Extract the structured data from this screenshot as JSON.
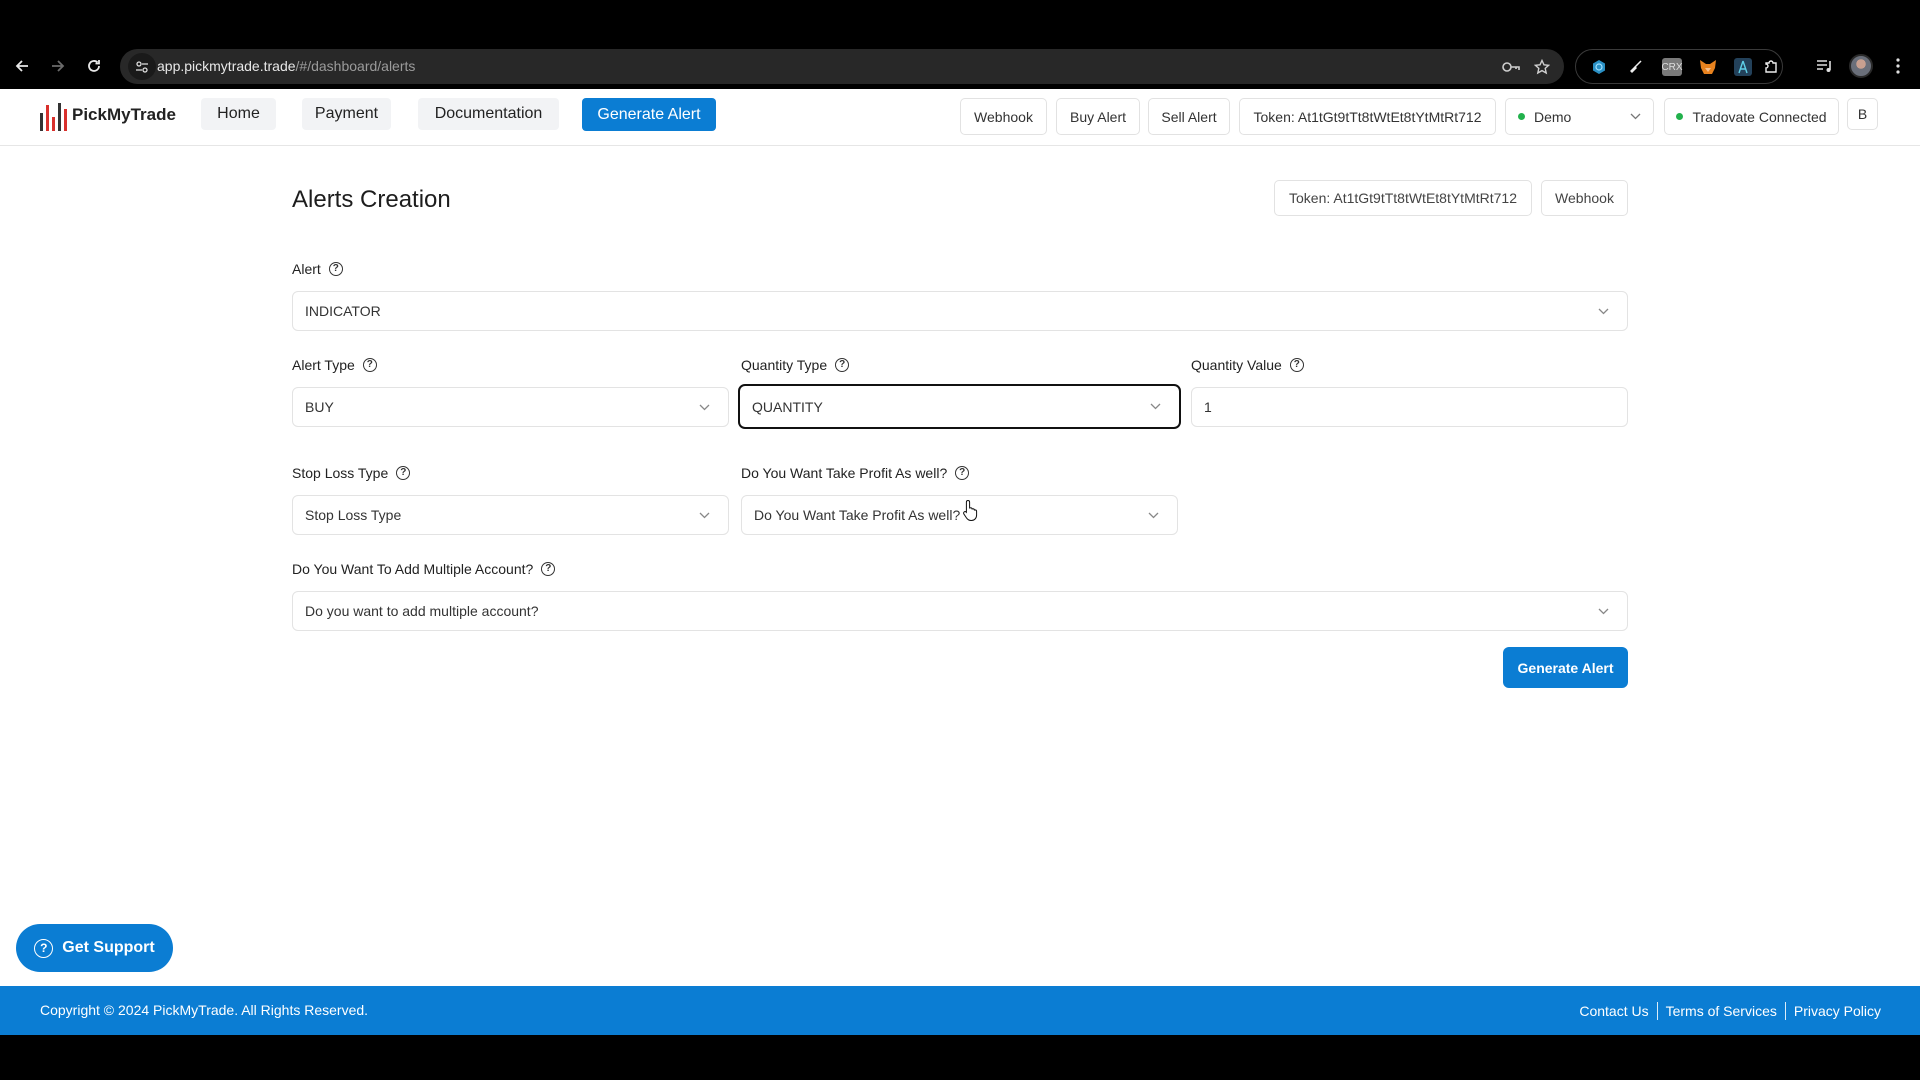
{
  "browser": {
    "url_host": "app.pickmytrade.trade",
    "url_path": "/#/dashboard/alerts",
    "nav": {
      "back": "back-icon",
      "forward": "forward-icon",
      "reload": "reload-icon"
    },
    "omnibox_icons": [
      "site-info-icon",
      "password-key-icon",
      "bookmark-star-icon"
    ],
    "extensions": [
      "web-extension-icon",
      "broom-extension-icon",
      "crx-extension-icon",
      "metamask-fox-icon",
      "compass-extension-icon",
      "puzzle-extensions-icon"
    ],
    "extension_crx_label": "CRX",
    "right_icons": [
      "media-queue-icon",
      "profile-avatar",
      "menu-kebab-icon"
    ]
  },
  "app": {
    "brand": "PickMyTrade",
    "nav": {
      "home": "Home",
      "payment": "Payment",
      "documentation": "Documentation",
      "generate_alert": "Generate Alert"
    },
    "topbar": {
      "webhook": "Webhook",
      "buy_alert": "Buy Alert",
      "sell_alert": "Sell Alert",
      "token": "Token: At1tGt9tTt8tWtEt8tYtMtRt712",
      "account_select": "Demo",
      "connection_status": "Tradovate Connected",
      "user_initial": "B"
    },
    "colors": {
      "primary": "#0b7dd3",
      "status_green": "#22b14c",
      "logo_red": "#d9302c",
      "logo_dark": "#333333"
    }
  },
  "page": {
    "title": "Alerts Creation",
    "token_button": "Token: At1tGt9tTt8tWtEt8tYtMtRt712",
    "webhook_button": "Webhook"
  },
  "form": {
    "alert": {
      "label": "Alert",
      "value": "INDICATOR"
    },
    "alert_type": {
      "label": "Alert Type",
      "value": "BUY"
    },
    "quantity_type": {
      "label": "Quantity Type",
      "value": "QUANTITY"
    },
    "quantity_value": {
      "label": "Quantity Value",
      "value": "1"
    },
    "stop_loss_type": {
      "label": "Stop Loss Type",
      "placeholder": "Stop Loss Type"
    },
    "take_profit": {
      "label": "Do You Want Take Profit As well?",
      "placeholder": "Do You Want Take Profit As well?"
    },
    "multiple_account": {
      "label": "Do You Want To Add Multiple Account?",
      "placeholder": "Do you want to add multiple account?"
    },
    "submit": "Generate Alert",
    "help_glyph": "?"
  },
  "support": {
    "label": "Get Support"
  },
  "footer": {
    "copyright": "Copyright © 2024 PickMyTrade. All Rights Reserved.",
    "links": [
      "Contact Us",
      "Terms of Services",
      "Privacy Policy"
    ]
  }
}
